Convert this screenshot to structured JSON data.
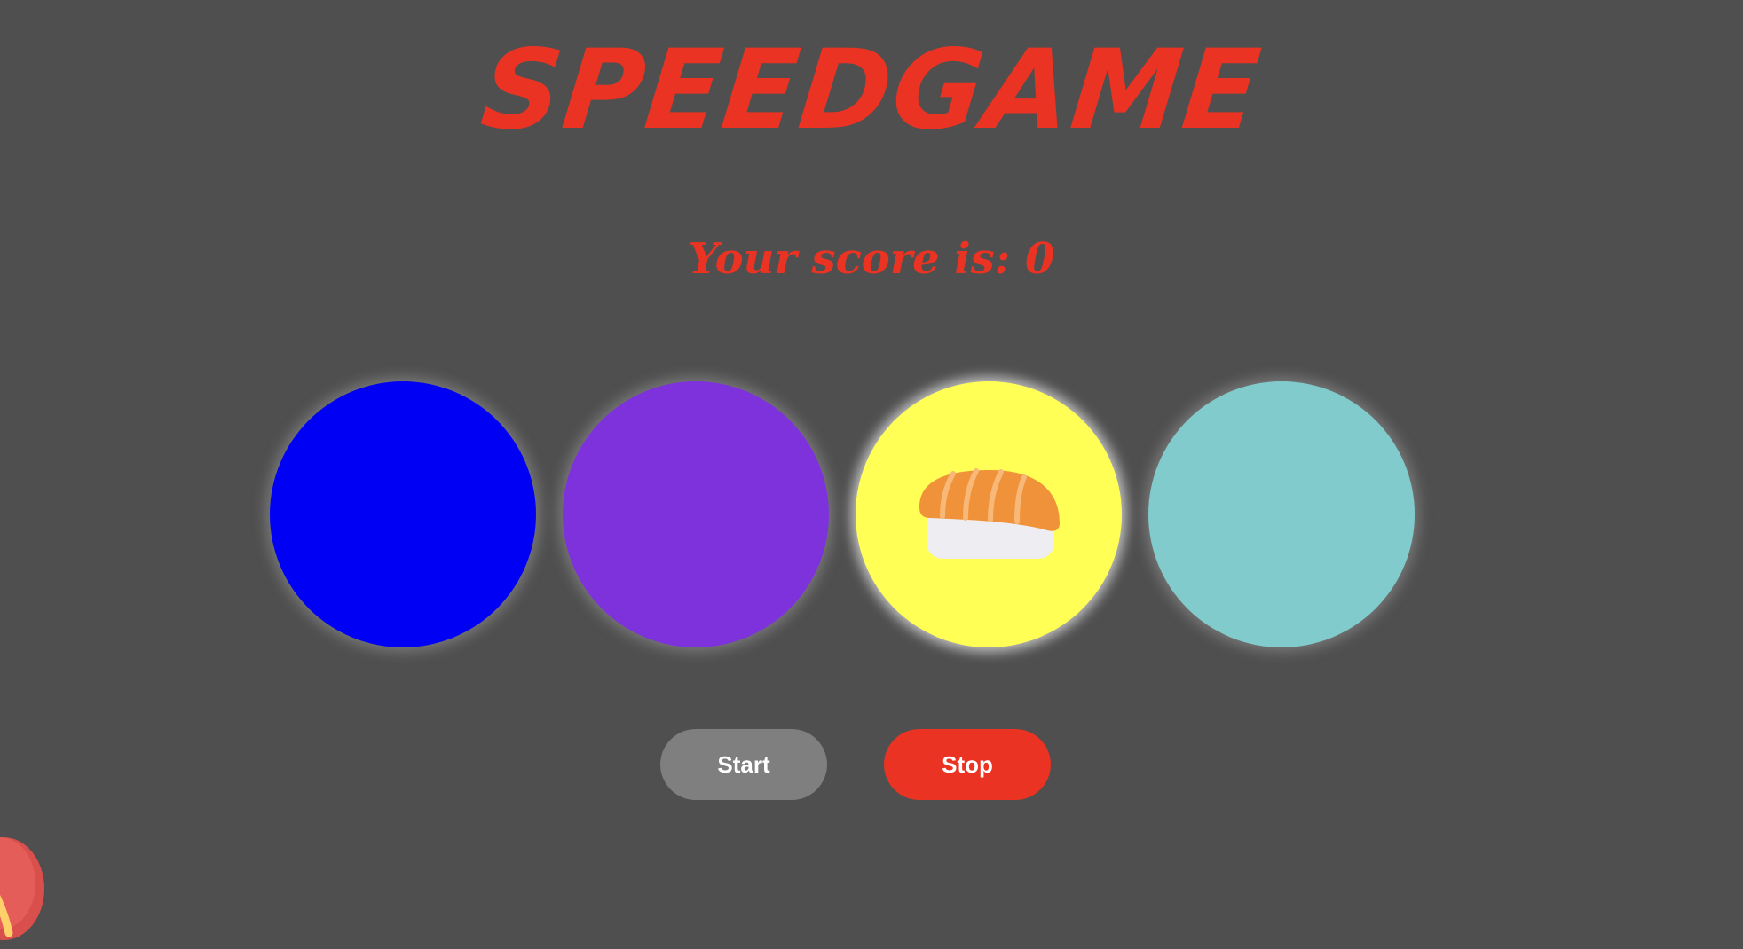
{
  "game": {
    "title": "SPEEDGAME",
    "score_text": "Your score is: 0"
  },
  "circles": [
    {
      "name": "circle-1",
      "color": "#0000f5",
      "active": false
    },
    {
      "name": "circle-2",
      "color": "#7d32dc",
      "active": false
    },
    {
      "name": "circle-3",
      "color": "#ffff55",
      "active": true,
      "icon": "sushi-icon"
    },
    {
      "name": "circle-4",
      "color": "#82cbcc",
      "active": false
    }
  ],
  "controls": {
    "start_label": "Start",
    "stop_label": "Stop"
  },
  "colors": {
    "background": "#4f4f4f",
    "accent": "#ea3323",
    "start_button": "#7f7f7f"
  }
}
